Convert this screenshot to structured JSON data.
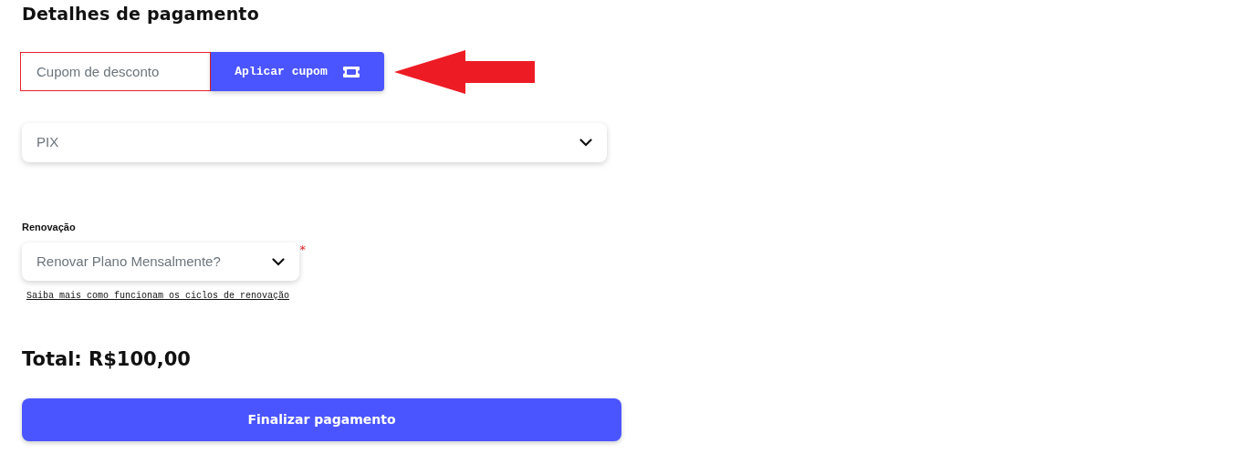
{
  "title": "Detalhes de pagamento",
  "coupon": {
    "placeholder": "Cupom de desconto",
    "button": "Aplicar cupom"
  },
  "payment_method": {
    "value": "PIX"
  },
  "renewal": {
    "label": "Renovação",
    "value": "Renovar Plano Mensalmente?",
    "required_mark": "*",
    "help_link": "Saiba mais como funcionam os ciclos de renovação"
  },
  "total": "Total: R$100,00",
  "submit": "Finalizar pagamento"
}
